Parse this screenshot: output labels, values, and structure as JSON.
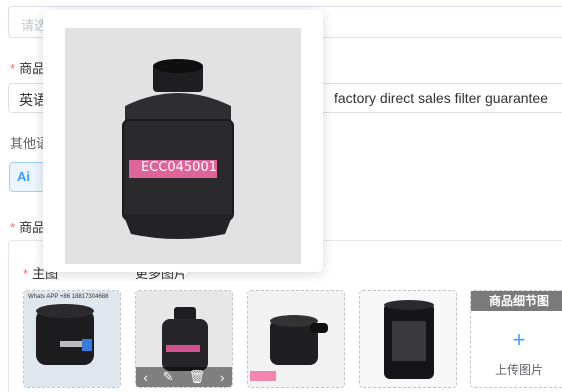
{
  "top_search": {
    "placeholder": "请选"
  },
  "product_title": {
    "label": "商品",
    "required_mark": "*",
    "lang": "英语",
    "value": "factory direct sales filter guarantee"
  },
  "other": {
    "label": "其他语"
  },
  "ai_button": {
    "label": "Ai"
  },
  "product_images": {
    "label": "商品",
    "required_mark": "*",
    "main_label": "主图",
    "more_label": "更多图片",
    "thumbs": [
      {
        "watermark": "Whats APP +86 18817304688"
      },
      {
        "tag": "ECC045001",
        "actions": [
          "‹",
          "✎",
          "🗑",
          "›"
        ]
      },
      {
        "badge": ""
      },
      {}
    ],
    "detail_card": {
      "header": "商品细节图",
      "plus": "+",
      "upload": "上传图片"
    }
  },
  "preview": {
    "tag": "ECC045001"
  },
  "colors": {
    "accent": "#409eff",
    "required": "#f56c6c",
    "border": "#dcdfe6"
  }
}
